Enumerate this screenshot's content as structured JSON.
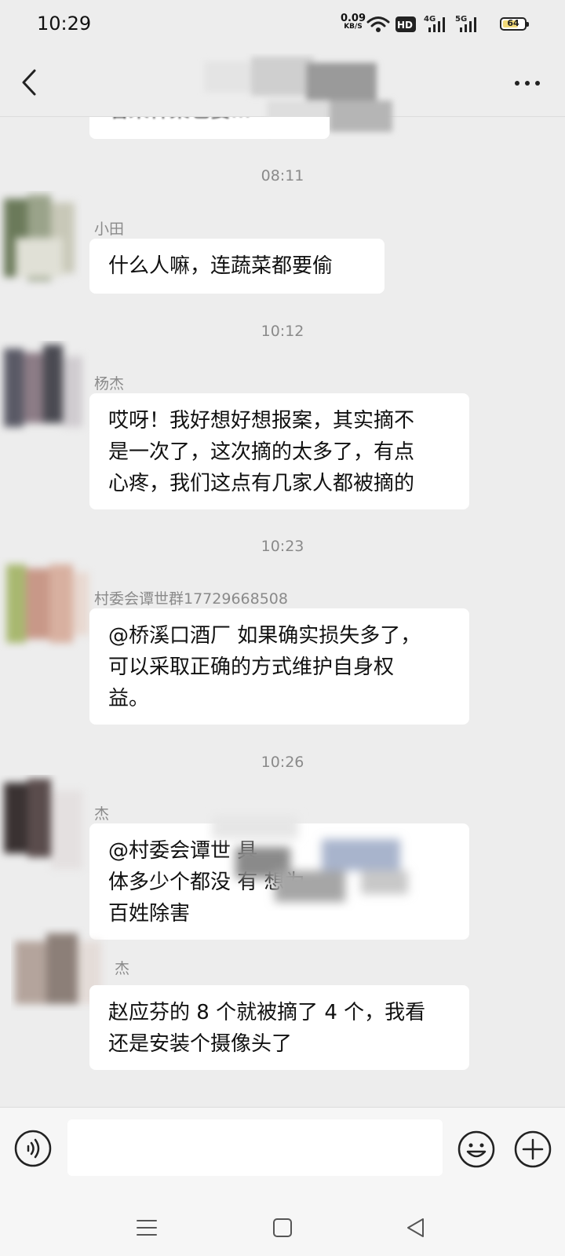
{
  "status_bar": {
    "time": "10:29",
    "net_speed_value": "0.09",
    "net_speed_unit": "KB/S",
    "hd_badge": "HD",
    "signal_1": "4G",
    "signal_2": "5G",
    "battery_level": "64",
    "icons": [
      "wifi-icon",
      "hd-voice-icon",
      "4g-signal-icon",
      "5g-signal-icon",
      "battery-icon"
    ]
  },
  "header": {
    "top_message_partial": "看来种菜也要…",
    "icons": [
      "back-arrow-icon",
      "more-icon"
    ]
  },
  "messages": [
    {
      "time": "08:11",
      "sender": "小田",
      "lines": [
        "什么人嘛，连蔬菜都要偷"
      ]
    },
    {
      "time": "10:12",
      "sender": "杨杰",
      "lines": [
        "哎呀！我好想好想报案，其实摘不",
        "是一次了，这次摘的太多了，有点",
        "心疼，我们这点有几家人都被摘的"
      ]
    },
    {
      "time": "10:23",
      "sender": "村委会谭世群17729668508",
      "lines": [
        "@桥溪口酒厂  如果确实损失多了，",
        "可以采取正确的方式维护自身权",
        "益。"
      ]
    },
    {
      "time": "10:26",
      "sender": "杰",
      "lines": [
        "@村委会谭世                      具",
        "体多少个都没             有        想为",
        "百姓除害"
      ]
    },
    {
      "time": "",
      "sender": "杰",
      "lines": [
        "赵应芬的 8 个就被摘了 4 个，我看",
        "还是安装个摄像头了"
      ]
    }
  ],
  "input_bar": {
    "placeholder": "",
    "value": "",
    "icons": [
      "voice-icon",
      "emoji-icon",
      "plus-icon"
    ]
  },
  "nav_bar": {
    "icons": [
      "menu-icon",
      "home-icon",
      "back-triangle-icon"
    ]
  },
  "colors": {
    "background": "#ededed",
    "bubble": "#ffffff",
    "timestamp": "#8a8a8a",
    "text": "#111111"
  }
}
